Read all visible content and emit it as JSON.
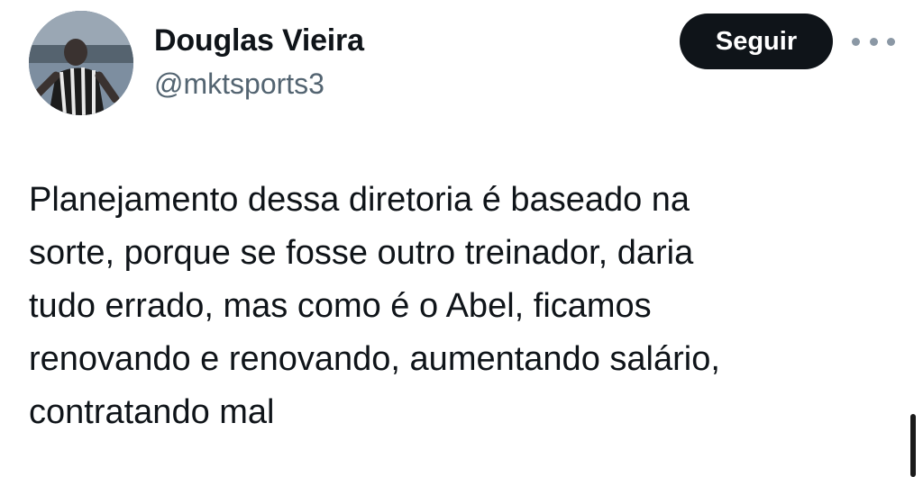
{
  "header": {
    "display_name": "Douglas Vieira",
    "handle": "@mktsports3",
    "follow_label": "Seguir",
    "avatar_icon": "profile-photo-soccer-player",
    "more_icon": "more-options-icon"
  },
  "tweet": {
    "text": "Planejamento dessa diretoria é baseado na\nsorte, porque se fosse outro treinador, daria\ntudo errado, mas como é o Abel, ficamos\nrenovando e renovando, aumentando salário,\ncontratando mal"
  },
  "colors": {
    "button_bg": "#0f1419",
    "handle_text": "#536471",
    "more_dots": "#8b98a5"
  }
}
